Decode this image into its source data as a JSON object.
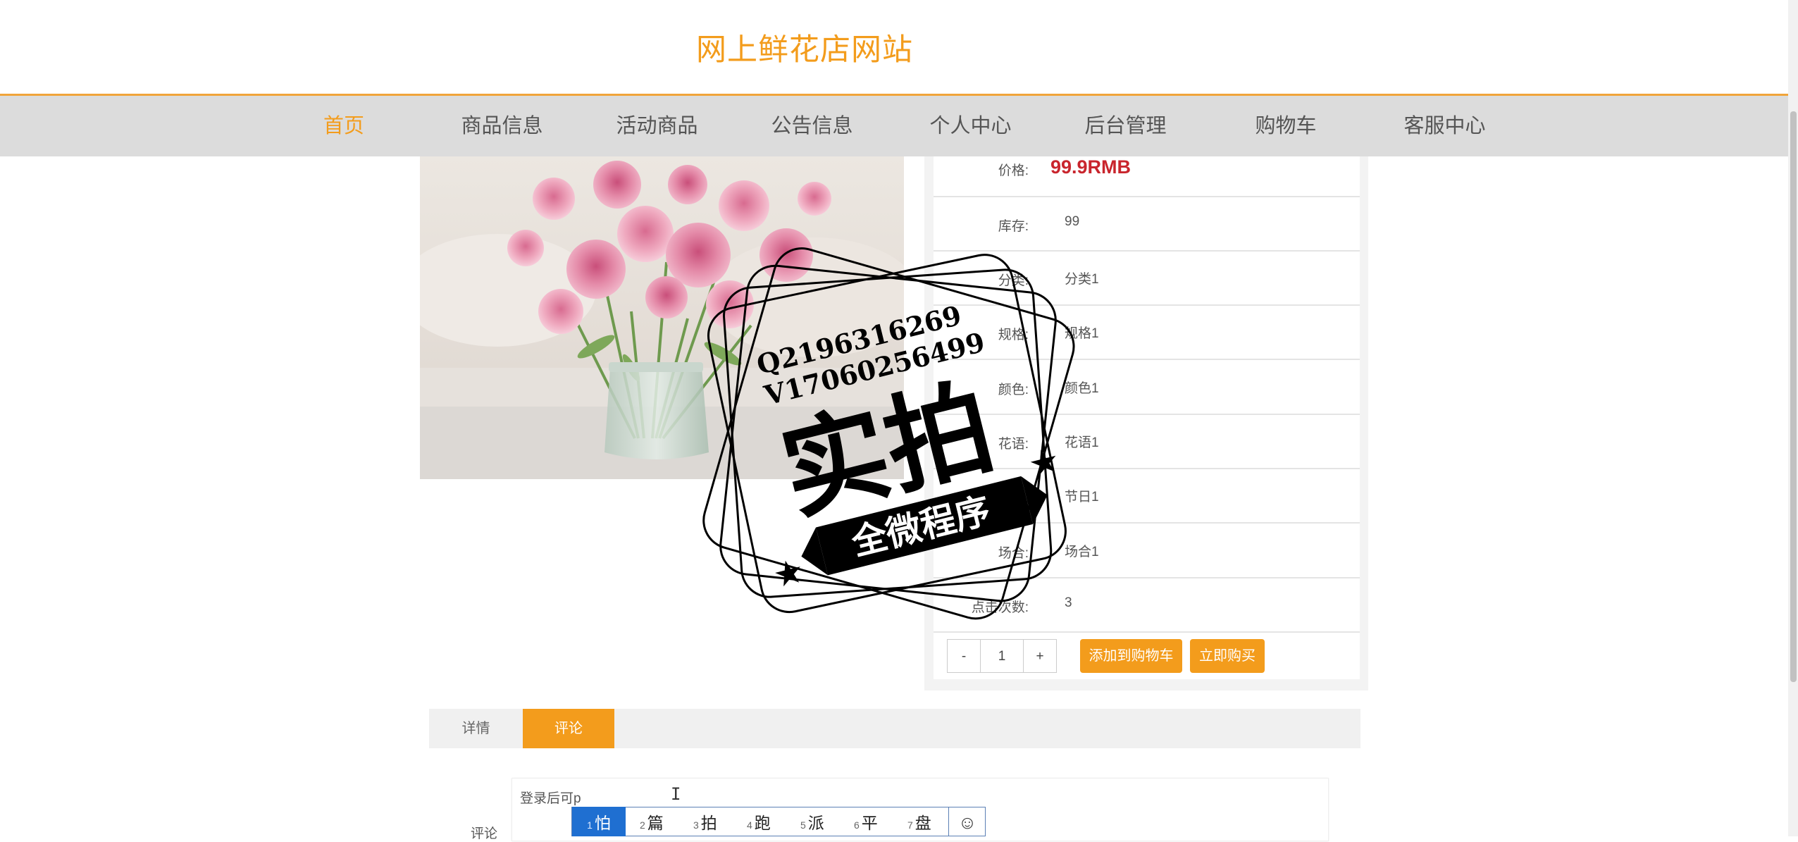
{
  "site": {
    "title": "网上鲜花店网站"
  },
  "nav": {
    "items": [
      {
        "label": "首页",
        "active": true
      },
      {
        "label": "商品信息"
      },
      {
        "label": "活动商品"
      },
      {
        "label": "公告信息"
      },
      {
        "label": "个人中心"
      },
      {
        "label": "后台管理"
      },
      {
        "label": "购物车"
      },
      {
        "label": "客服中心"
      }
    ]
  },
  "product": {
    "rows": [
      {
        "label": "价格:",
        "value": "99.9RMB"
      },
      {
        "label": "库存:",
        "value": "99"
      },
      {
        "label": "分类:",
        "value": "分类1"
      },
      {
        "label": "规格:",
        "value": "规格1"
      },
      {
        "label": "颜色:",
        "value": "颜色1"
      },
      {
        "label": "花语:",
        "value": "花语1"
      },
      {
        "label": "节日:",
        "value": "节日1"
      },
      {
        "label": "场合:",
        "value": "场合1"
      },
      {
        "label": "点击次数:",
        "value": "3"
      }
    ],
    "quantity": {
      "minus": "-",
      "value": "1",
      "plus": "+"
    },
    "buttons": {
      "add_to_cart": "添加到购物车",
      "buy_now": "立即购买"
    }
  },
  "tabs": [
    {
      "label": "详情"
    },
    {
      "label": "评论",
      "active": true
    }
  ],
  "comment": {
    "label": "评论",
    "text": "登录后可p"
  },
  "ime": {
    "candidates": [
      {
        "num": "1",
        "char": "怕"
      },
      {
        "num": "2",
        "char": "篇"
      },
      {
        "num": "3",
        "char": "拍"
      },
      {
        "num": "4",
        "char": "跑"
      },
      {
        "num": "5",
        "char": "派"
      },
      {
        "num": "6",
        "char": "平"
      },
      {
        "num": "7",
        "char": "盘"
      }
    ],
    "emoji": "☺"
  },
  "watermark": {
    "line1": "Q2196316269",
    "line2": "V17060256499",
    "main": "实拍",
    "banner": "全微程序"
  },
  "colors": {
    "accent": "#f39c1c",
    "price": "#c9252d",
    "nav_bg": "#dcdcdc",
    "ime_highlight": "#1f6fd1"
  }
}
